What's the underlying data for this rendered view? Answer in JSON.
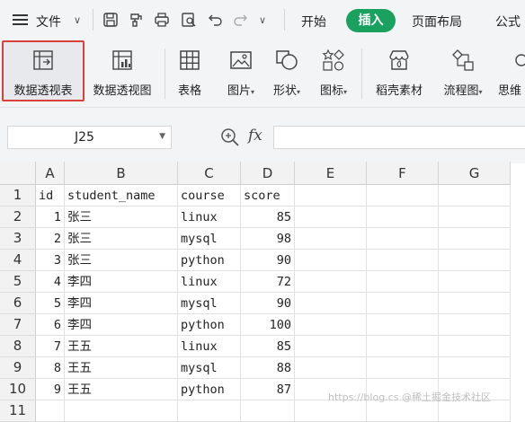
{
  "menu": {
    "file_label": "文件",
    "tabs": [
      "开始",
      "插入",
      "页面布局",
      "公式"
    ],
    "active_tab": "插入"
  },
  "ribbon": {
    "tools": [
      {
        "label": "数据透视表",
        "icon": "pivot-table-icon"
      },
      {
        "label": "数据透视图",
        "icon": "pivot-chart-icon"
      },
      {
        "label": "表格",
        "icon": "table-icon"
      },
      {
        "label": "图片",
        "icon": "picture-icon"
      },
      {
        "label": "形状",
        "icon": "shapes-icon"
      },
      {
        "label": "图标",
        "icon": "icons-icon"
      },
      {
        "label": "稻壳素材",
        "icon": "material-store-icon"
      },
      {
        "label": "流程图",
        "icon": "flowchart-icon"
      },
      {
        "label": "思维",
        "icon": "mindmap-icon"
      }
    ],
    "highlighted_tool": "数据透视表",
    "highlight_color": "#d9423a"
  },
  "formula_bar": {
    "name_box": "J25",
    "fx_label": "fx",
    "formula": ""
  },
  "sheet": {
    "columns": [
      "A",
      "B",
      "C",
      "D",
      "E",
      "F",
      "G"
    ],
    "row_numbers": [
      "1",
      "2",
      "3",
      "4",
      "5",
      "6",
      "7",
      "8",
      "9",
      "10",
      "11"
    ],
    "header": [
      "id",
      "student_name",
      "course",
      "score"
    ],
    "rows": [
      [
        "1",
        "张三",
        "linux",
        "85"
      ],
      [
        "2",
        "张三",
        "mysql",
        "98"
      ],
      [
        "3",
        "张三",
        "python",
        "90"
      ],
      [
        "4",
        "李四",
        "linux",
        "72"
      ],
      [
        "5",
        "李四",
        "mysql",
        "90"
      ],
      [
        "6",
        "李四",
        "python",
        "100"
      ],
      [
        "7",
        "王五",
        "linux",
        "85"
      ],
      [
        "8",
        "王五",
        "mysql",
        "88"
      ],
      [
        "9",
        "王五",
        "python",
        "87"
      ]
    ]
  },
  "watermark": "https://blog.cs @稀土掘金技术社区",
  "colors": {
    "accent": "#1aa15f",
    "ribbon_bg": "#f3f4f6"
  }
}
